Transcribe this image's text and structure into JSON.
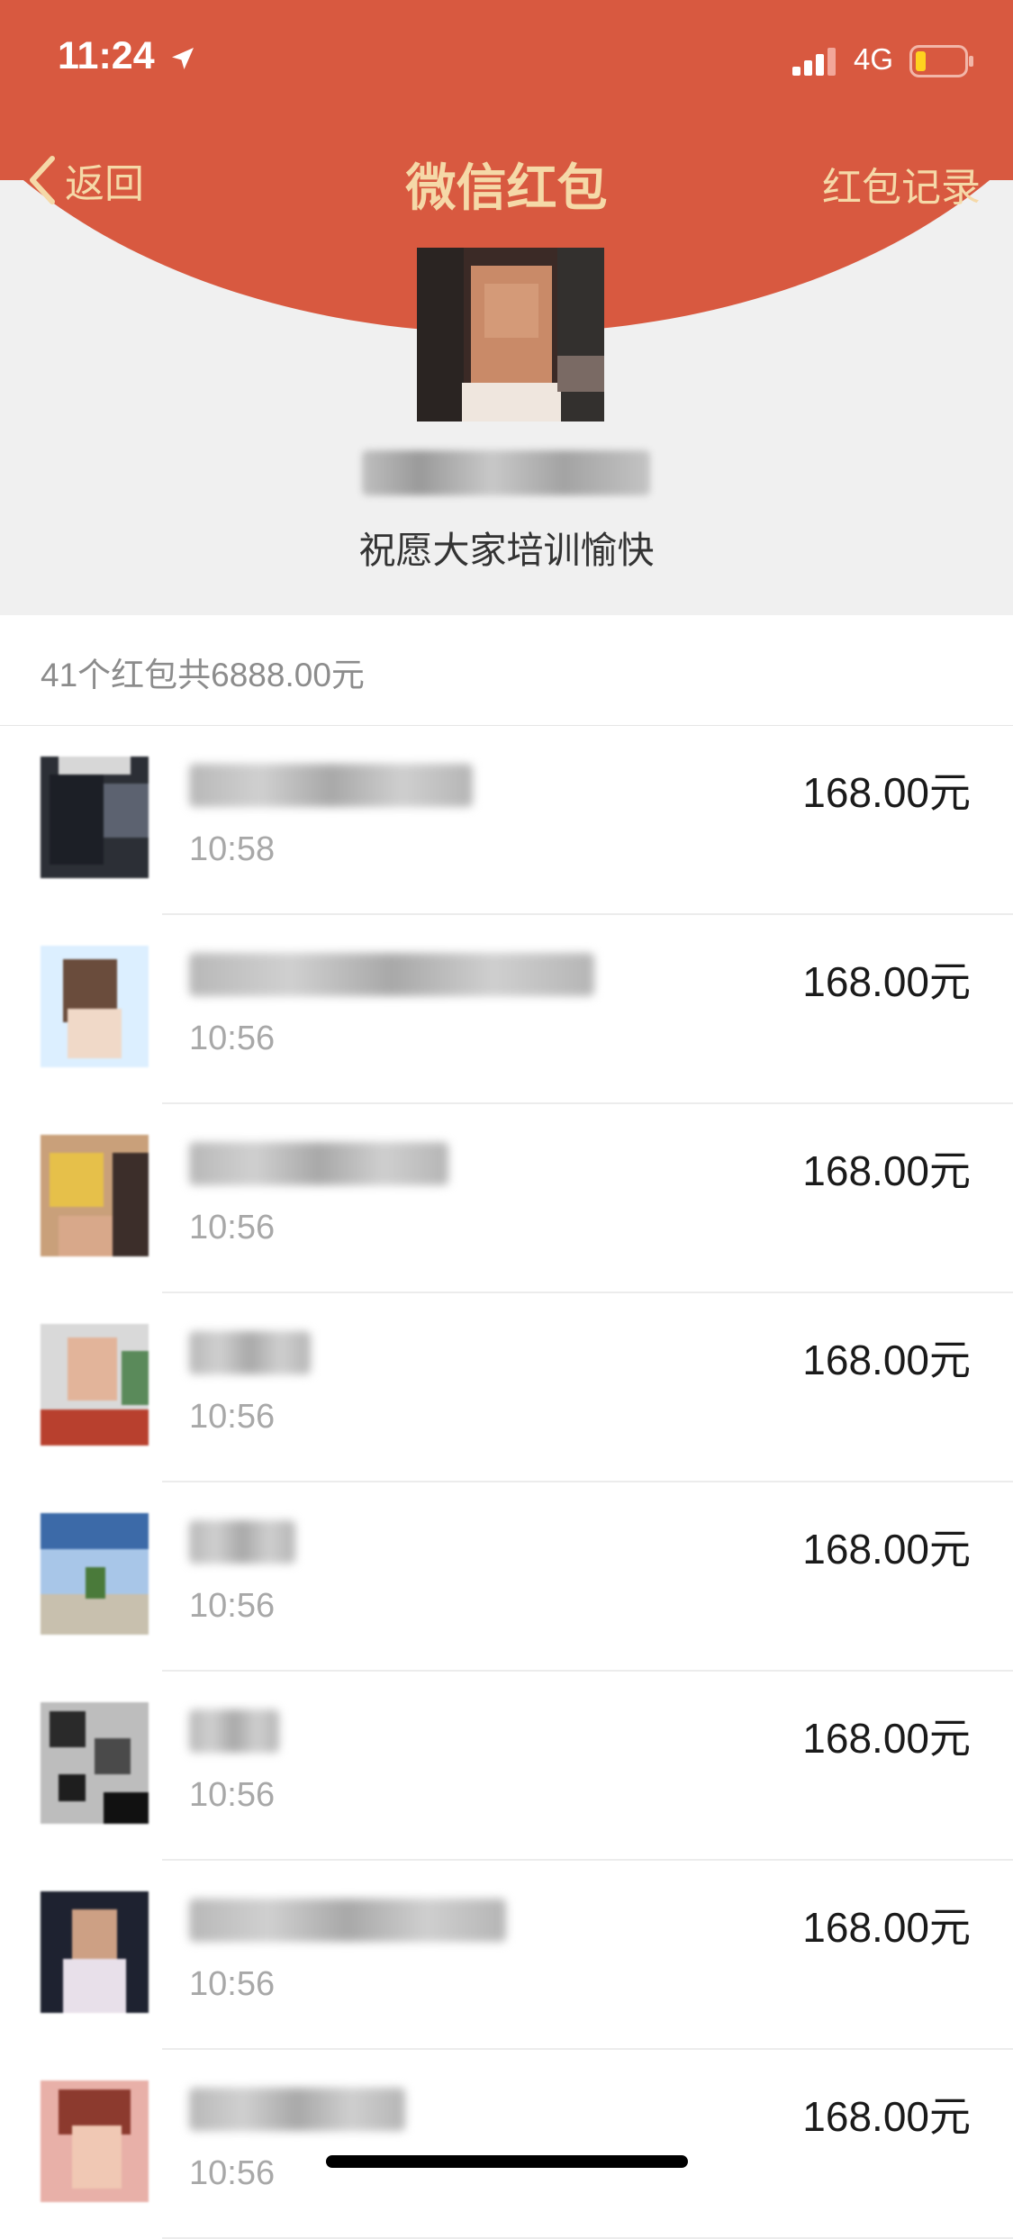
{
  "status_bar": {
    "time": "11:24",
    "network": "4G"
  },
  "nav": {
    "back_label": "返回",
    "title": "微信红包",
    "right_label": "红包记录"
  },
  "packet": {
    "blessing": "祝愿大家培训愉快"
  },
  "summary": {
    "text": "41个红包共6888.00元"
  },
  "records": [
    {
      "time": "10:58",
      "amount": "168.00元"
    },
    {
      "time": "10:56",
      "amount": "168.00元"
    },
    {
      "time": "10:56",
      "amount": "168.00元"
    },
    {
      "time": "10:56",
      "amount": "168.00元"
    },
    {
      "time": "10:56",
      "amount": "168.00元"
    },
    {
      "time": "10:56",
      "amount": "168.00元"
    },
    {
      "time": "10:56",
      "amount": "168.00元"
    },
    {
      "time": "10:56",
      "amount": "168.00元"
    }
  ],
  "colors": {
    "header_red": "#d85940",
    "gold_text": "#f5d9a8"
  }
}
